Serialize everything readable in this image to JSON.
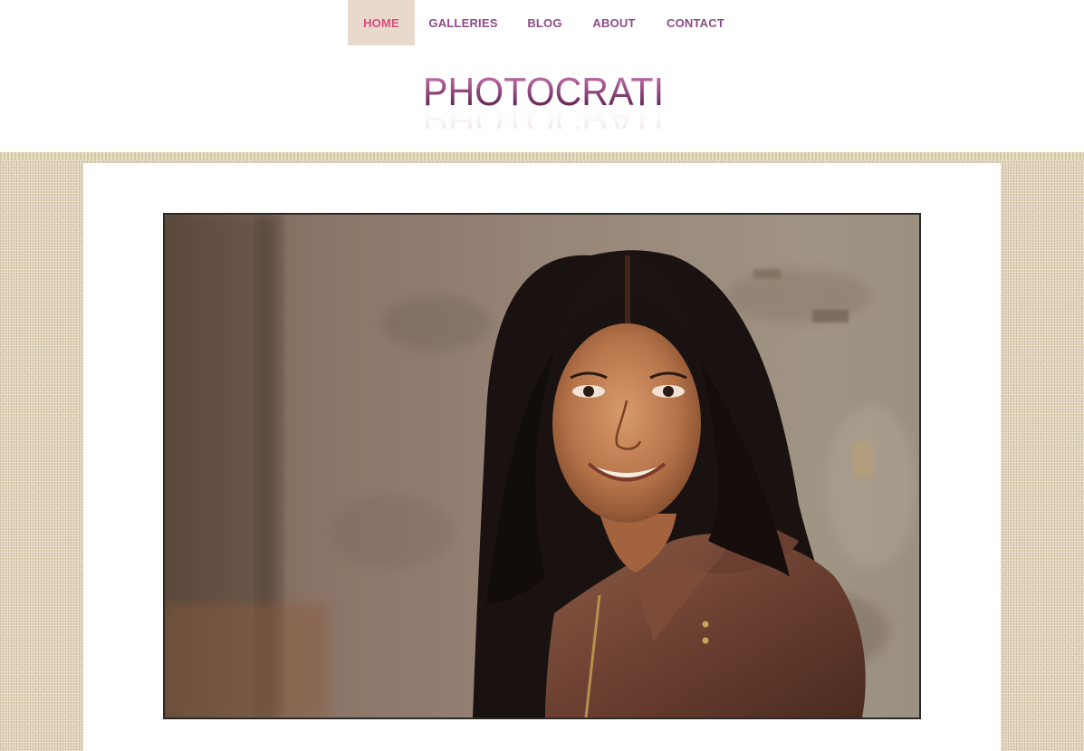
{
  "nav": {
    "items": [
      {
        "label": "HOME",
        "active": true
      },
      {
        "label": "GALLERIES",
        "active": false
      },
      {
        "label": "BLOG",
        "active": false
      },
      {
        "label": "ABOUT",
        "active": false
      },
      {
        "label": "CONTACT",
        "active": false
      }
    ]
  },
  "logo": {
    "text": "PHOTOCRATI"
  },
  "colors": {
    "nav_text": "#8f4a86",
    "nav_active_text": "#d64f7c",
    "nav_active_bg": "#e9d8cc",
    "logo_top": "#d27cb8",
    "logo_bottom": "#4c1240",
    "backdrop": "#e0d4b9",
    "panel": "#ffffff",
    "photo_border": "#2c2a28"
  }
}
